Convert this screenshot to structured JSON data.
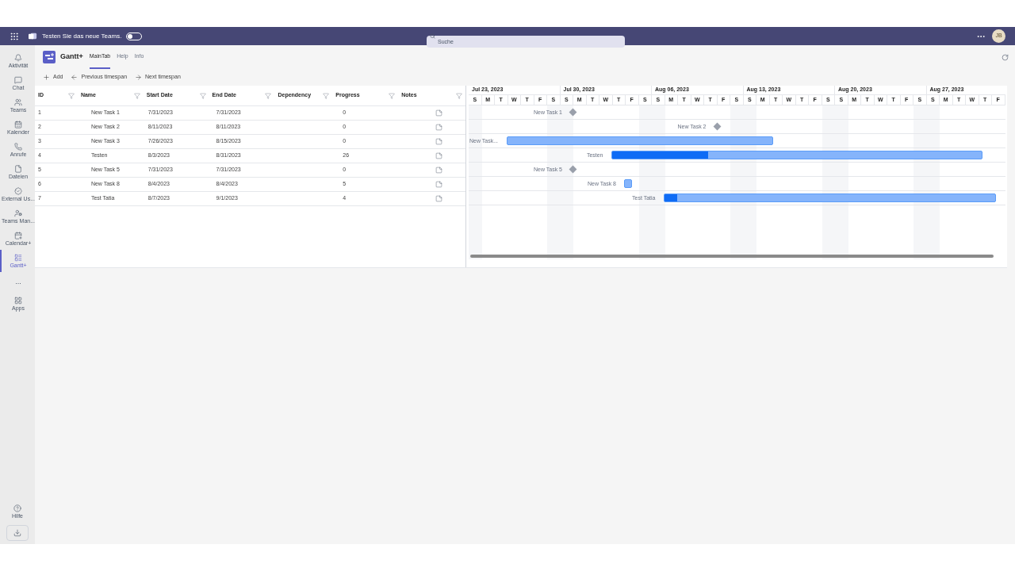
{
  "top_bar": {
    "promo": "Testen Sie das neue Teams.",
    "toggle_on": false,
    "search": {
      "placeholder": "Suche"
    },
    "avatar": "JB"
  },
  "rail": [
    {
      "label": "Aktivität",
      "selected": false
    },
    {
      "label": "Chat",
      "selected": false
    },
    {
      "label": "Teams",
      "selected": false
    },
    {
      "label": "Kalender",
      "selected": false
    },
    {
      "label": "Anrufe",
      "selected": false
    },
    {
      "label": "Dateien",
      "selected": false
    },
    {
      "label": "External Us...",
      "selected": false
    },
    {
      "label": "Teams Man...",
      "selected": false
    },
    {
      "label": "Calendar+",
      "selected": false
    },
    {
      "label": "Gantt+",
      "selected": true
    },
    {
      "label": "...",
      "kind": "more",
      "selected": false
    },
    {
      "label": "Apps",
      "selected": false
    }
  ],
  "rail_bottom": {
    "label": "Hilfe"
  },
  "app": {
    "title": "Gantt+",
    "tabs": [
      {
        "label": "MainTab",
        "selected": true
      },
      {
        "label": "Help",
        "selected": false
      },
      {
        "label": "Info",
        "selected": false
      }
    ]
  },
  "toolbar": [
    "Add",
    "Previous timespan",
    "Next timespan"
  ],
  "table": {
    "columns": [
      "ID",
      "Name",
      "Start Date",
      "End Date",
      "Dependency",
      "Progress",
      "Notes"
    ],
    "rows": [
      {
        "id": "1",
        "name": "New Task 1",
        "start": "7/31/2023",
        "end": "7/31/2023",
        "progress": "0"
      },
      {
        "id": "2",
        "name": "New Task 2",
        "start": "8/11/2023",
        "end": "8/11/2023",
        "progress": "0"
      },
      {
        "id": "3",
        "name": "New Task 3",
        "start": "7/26/2023",
        "end": "8/15/2023",
        "progress": "0"
      },
      {
        "id": "4",
        "name": "Testen",
        "start": "8/3/2023",
        "end": "8/31/2023",
        "progress": "26"
      },
      {
        "id": "5",
        "name": "New Task 5",
        "start": "7/31/2023",
        "end": "7/31/2023",
        "progress": "0"
      },
      {
        "id": "6",
        "name": "New Task 8",
        "start": "8/4/2023",
        "end": "8/4/2023",
        "progress": "5"
      },
      {
        "id": "7",
        "name": "Test Tatia",
        "start": "8/7/2023",
        "end": "9/1/2023",
        "progress": "4"
      }
    ]
  },
  "gantt": {
    "weeks": [
      "Jul 23, 2023",
      "Jul 30, 2023",
      "Aug 06, 2023",
      "Aug 13, 2023",
      "Aug 20, 2023",
      "Aug 27, 2023"
    ],
    "day_letters": [
      "S",
      "M",
      "T",
      "W",
      "T",
      "F",
      "S",
      "S",
      "M",
      "T",
      "W",
      "T",
      "F",
      "S",
      "S",
      "M",
      "T",
      "W",
      "T",
      "F",
      "S",
      "S",
      "M",
      "T",
      "W",
      "T",
      "F",
      "S",
      "S",
      "M",
      "T",
      "W",
      "T",
      "F",
      "S",
      "S",
      "M",
      "T",
      "W",
      "T",
      "F"
    ],
    "tasks": [
      {
        "label": "New Task 1",
        "kind": "milestone"
      },
      {
        "label": "New Task 2",
        "kind": "milestone"
      },
      {
        "label": "New Task...",
        "kind": "bar"
      },
      {
        "label": "Testen",
        "kind": "bar",
        "level": 0.26
      },
      {
        "label": "New Task 5",
        "kind": "milestone"
      },
      {
        "label": "New Task 8",
        "kind": "bar"
      },
      {
        "label": "Test Tatia",
        "kind": "bar",
        "level": 0.04
      }
    ]
  }
}
